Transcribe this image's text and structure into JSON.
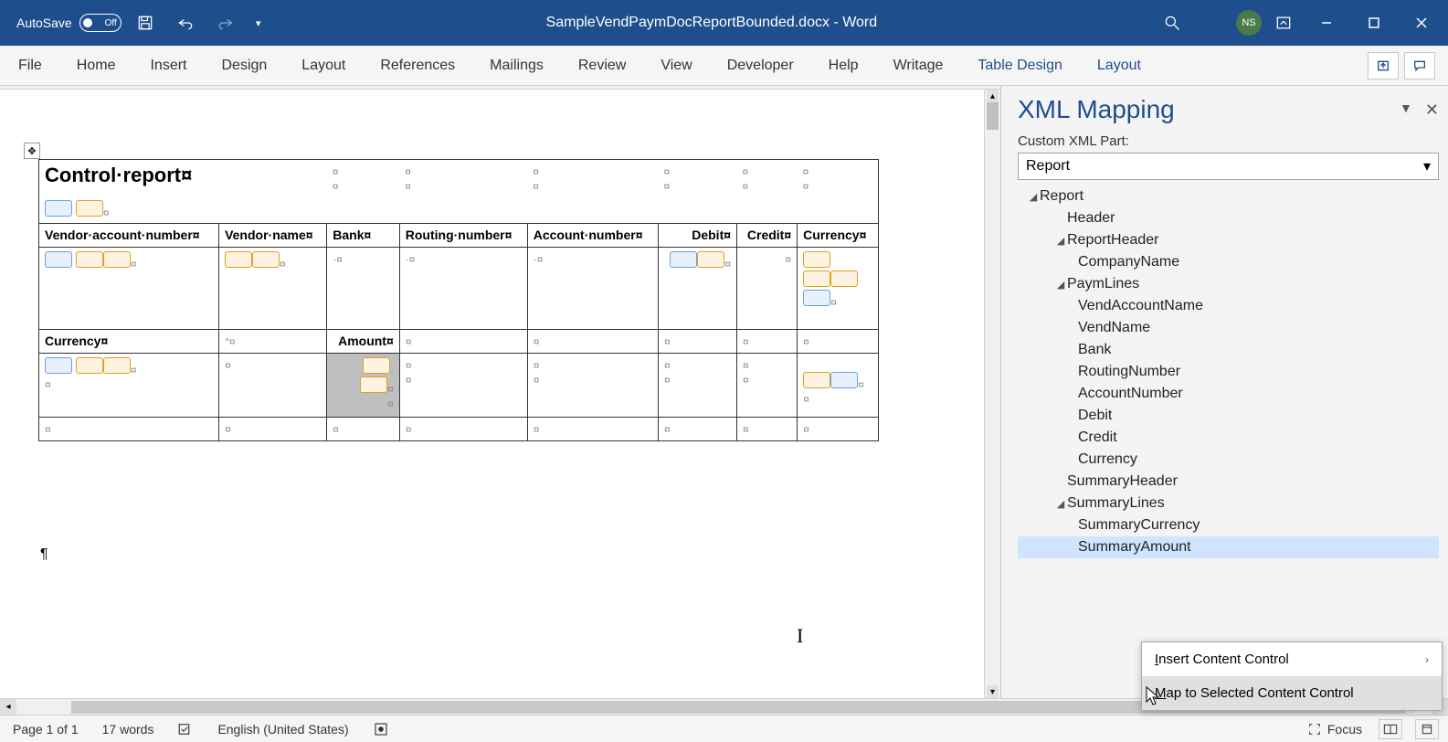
{
  "titlebar": {
    "autosave_label": "AutoSave",
    "autosave_state": "Off",
    "document": "SampleVendPaymDocReportBounded.docx",
    "app_suffix": " -  Word",
    "user_initials": "NS"
  },
  "ribbon": {
    "tabs": [
      "File",
      "Home",
      "Insert",
      "Design",
      "Layout",
      "References",
      "Mailings",
      "Review",
      "View",
      "Developer",
      "Help",
      "Writage"
    ],
    "context_tabs": [
      "Table Design",
      "Layout"
    ]
  },
  "document": {
    "title": "Control·report¤",
    "headers": {
      "vend_acct": "Vendor·account·number¤",
      "vend_name": "Vendor·name¤",
      "bank": "Bank¤",
      "routing": "Routing·number¤",
      "acct_num": "Account·number¤",
      "debit": "Debit¤",
      "credit": "Credit¤",
      "currency": "Currency¤"
    },
    "summary_headers": {
      "currency": "Currency¤",
      "amount": "Amount¤"
    },
    "pilcrow": "¶"
  },
  "pane": {
    "title": "XML Mapping",
    "label": "Custom XML Part:",
    "selected_part": "Report",
    "tree": {
      "root": "Report",
      "header": "Header",
      "report_header": "ReportHeader",
      "company_name": "CompanyName",
      "paym_lines": "PaymLines",
      "paym_children": [
        "VendAccountName",
        "VendName",
        "Bank",
        "RoutingNumber",
        "AccountNumber",
        "Debit",
        "Credit",
        "Currency"
      ],
      "summary_header": "SummaryHeader",
      "summary_lines": "SummaryLines",
      "summary_children": [
        "SummaryCurrency",
        "SummaryAmount"
      ]
    },
    "context_menu": {
      "insert": "nsert Content Control",
      "insert_ul": "I",
      "map": "ap to Selected Content Control",
      "map_ul": "M"
    }
  },
  "statusbar": {
    "page": "Page 1 of 1",
    "words": "17 words",
    "language": "English (United States)",
    "focus": "Focus"
  }
}
